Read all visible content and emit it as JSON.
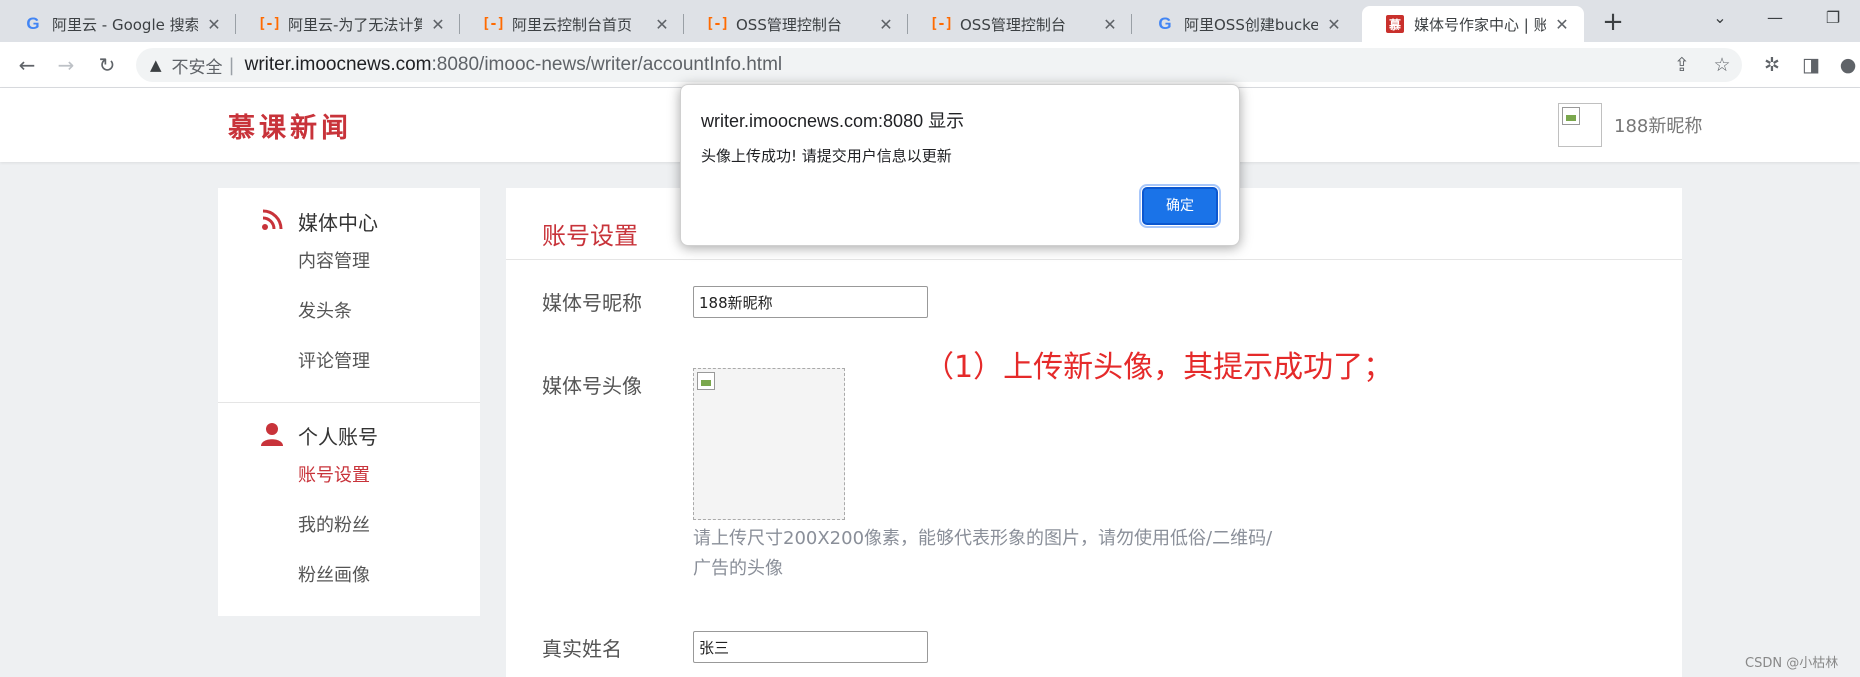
{
  "browser": {
    "tabs": [
      {
        "title": "阿里云 - Google 搜索",
        "icon": "google-icon"
      },
      {
        "title": "阿里云-为了无法计算的价值",
        "icon": "aliyun-icon"
      },
      {
        "title": "阿里云控制台首页",
        "icon": "aliyun-icon"
      },
      {
        "title": "OSS管理控制台",
        "icon": "aliyun-icon"
      },
      {
        "title": "OSS管理控制台",
        "icon": "aliyun-icon"
      },
      {
        "title": "阿里OSS创建bucket",
        "icon": "google-icon"
      },
      {
        "title": "媒体号作家中心 | 账号",
        "icon": "mooc-icon",
        "active": true
      }
    ],
    "tab_close": "✕",
    "new_tab": "+",
    "address": {
      "security_label": "不安全",
      "separator": "|",
      "host": "writer.imoocnews.com",
      "path": ":8080/imooc-news/writer/accountInfo.html"
    }
  },
  "site": {
    "logo": "慕课新闻",
    "user_nickname": "188新昵称"
  },
  "sidebar": {
    "sections": [
      {
        "title": "媒体中心",
        "icon": "rss-icon",
        "items": [
          "内容管理",
          "发头条",
          "评论管理"
        ]
      },
      {
        "title": "个人账号",
        "icon": "user-icon",
        "items": [
          "账号设置",
          "我的粉丝",
          "粉丝画像"
        ],
        "active_index": 0
      }
    ]
  },
  "main": {
    "title": "账号设置",
    "fields": {
      "nickname_label": "媒体号昵称",
      "nickname_value": "188新昵称",
      "avatar_label": "媒体号头像",
      "avatar_hint": "请上传尺寸200X200像素，能够代表形象的图片，请勿使用低俗/二维码/广告的头像",
      "realname_label": "真实姓名",
      "realname_value": "张三"
    },
    "annotation": "（1）上传新头像，其提示成功了；"
  },
  "dialog": {
    "title": "writer.imoocnews.com:8080 显示",
    "message": "头像上传成功! 请提交用户信息以更新",
    "ok_label": "确定"
  },
  "watermark": "CSDN @小枯林",
  "colors": {
    "brand_red": "#c8333a",
    "annotation_red": "#e52a2a",
    "dialog_button": "#1a73e8"
  }
}
